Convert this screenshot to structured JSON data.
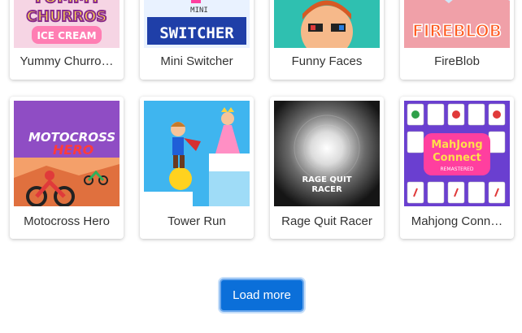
{
  "games": [
    {
      "title": "Yummy Churro…",
      "thumb_text": [
        "YUMMY",
        "CHURROS",
        "ICE CREAM"
      ]
    },
    {
      "title": "Mini Switcher",
      "thumb_text": [
        "MINI",
        "SWITCHER"
      ]
    },
    {
      "title": "Funny Faces"
    },
    {
      "title": "FireBlob",
      "thumb_text": [
        "FIREBLOB"
      ]
    },
    {
      "title": "Motocross Hero",
      "thumb_text": [
        "MOTOCROSS",
        "HERO"
      ]
    },
    {
      "title": "Tower Run"
    },
    {
      "title": "Rage Quit Racer",
      "thumb_text": [
        "RAGE QUIT",
        "RACER"
      ]
    },
    {
      "title": "Mahjong Conn…",
      "thumb_text": [
        "MahJong",
        "Connect",
        "REMASTERED"
      ]
    }
  ],
  "load_more": {
    "label": "Load more"
  }
}
